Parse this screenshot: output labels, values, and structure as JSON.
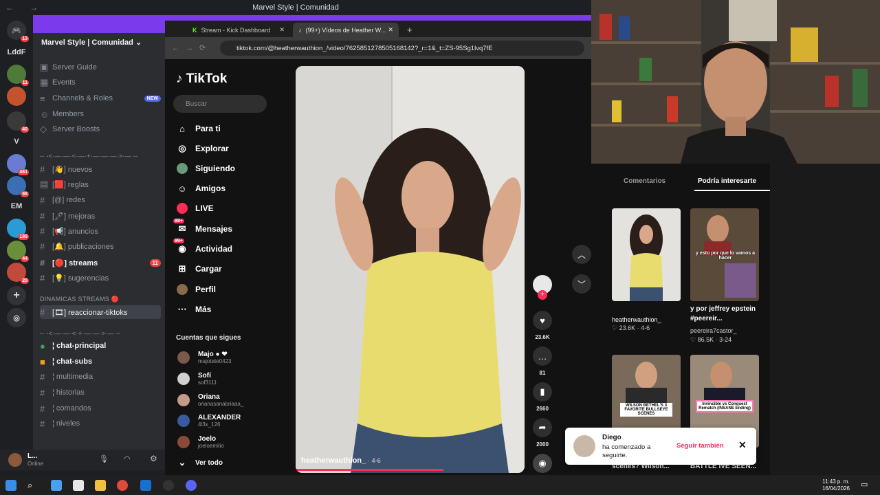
{
  "window_title": "Marvel Style | Comunidad",
  "discord": {
    "guild_name": "Marvel Style | Comunidad",
    "top_items": [
      {
        "label": "Server Guide"
      },
      {
        "label": "Events"
      },
      {
        "label": "Channels & Roles",
        "badge": "NEW"
      },
      {
        "label": "Members"
      },
      {
        "label": "Server Boosts"
      }
    ],
    "divider_1": "-- -<·—·—·<·—·+·—·—·—·>·— --",
    "channels_1": [
      {
        "label": "[👋] nuevos"
      },
      {
        "label": "[🟥] reglas"
      },
      {
        "label": "[@] redes"
      },
      {
        "label": "[🖊] mejoras"
      },
      {
        "label": "[📢] anuncios"
      },
      {
        "label": "[🔔] publicaciones"
      },
      {
        "label": "[🔴] streams",
        "badge": "11"
      },
      {
        "label": "[💡] sugerencias"
      }
    ],
    "category_dinamicas": "DINAMICAS STREAMS 🔴",
    "active_channel": "[🎞] reaccionar-tiktoks",
    "divider_2": "-- -<·—·—·<·+·—·—·>·— --",
    "channels_2": [
      {
        "label": "¦ chat-principal"
      },
      {
        "label": "¦ chat-subs"
      },
      {
        "label": "¦ multimedia"
      },
      {
        "label": "¦ historias"
      },
      {
        "label": "¦ comandos"
      },
      {
        "label": "¦ niveles"
      }
    ],
    "user_name": "L...",
    "user_status": "Online",
    "server_labels": [
      "LddF",
      "V",
      "EM"
    ],
    "server_badges": [
      "13",
      "11",
      "40",
      "461",
      "98",
      "189",
      "44",
      "20"
    ]
  },
  "browser": {
    "tab1": "Stream - Kick Dashboard",
    "tab2": "(99+) Vídeos de Heather W...",
    "url": "tiktok.com/@heatherwauthion_/video/7625851278505168142?_r=1&_t=ZS-95Sg1lvq7fE"
  },
  "tiktok": {
    "logo": "TikTok",
    "search_placeholder": "Buscar",
    "menu": [
      {
        "label": "Para ti",
        "icon": "home-icon"
      },
      {
        "label": "Explorar",
        "icon": "compass-icon"
      },
      {
        "label": "Siguiendo",
        "icon": "following-icon"
      },
      {
        "label": "Amigos",
        "icon": "friends-icon"
      },
      {
        "label": "LIVE",
        "icon": "live-icon"
      },
      {
        "label": "Mensajes",
        "icon": "messages-icon",
        "badge": "99+"
      },
      {
        "label": "Actividad",
        "icon": "activity-icon",
        "badge": "99+"
      },
      {
        "label": "Cargar",
        "icon": "upload-icon"
      },
      {
        "label": "Perfil",
        "icon": "profile-icon"
      },
      {
        "label": "Más",
        "icon": "more-icon"
      }
    ],
    "following_title": "Cuentas que sigues",
    "following": [
      {
        "name": "Majo ● ❤",
        "handle": "majotete0423"
      },
      {
        "name": "Sofí",
        "handle": "sof3111"
      },
      {
        "name": "Oriana",
        "handle": "orianasanabriaaa_"
      },
      {
        "name": "ALEXANDER",
        "handle": "4l3x_126"
      },
      {
        "name": "Joelo",
        "handle": "joeloemilio"
      }
    ],
    "see_all": "Ver todo",
    "video_author": "heatherwauthion_",
    "video_date": "· 4-6",
    "actions": {
      "likes": "23.6K",
      "comments": "81",
      "saves": "2660",
      "shares": "2000"
    },
    "right_tabs": [
      "Comentarios",
      "Podría interesarte"
    ],
    "suggestions": [
      {
        "title": "",
        "author": "heatherwauthion_",
        "meta": "♡ 23.6K · 4-6",
        "overlay": ""
      },
      {
        "title": "y por jeffrey epstein #peereir...",
        "author": "peereira7castor_",
        "meta": "♡ 86.5K · 3-24",
        "overlay": "y esto por que lo vamos a hacer"
      },
      {
        "title": "scenes? Wilson...",
        "author": "",
        "meta": "",
        "overlay": "WILSON BETHEL'S 3 FAVORITE BULLSEYE SCENES"
      },
      {
        "title": "BATTLE IVE SEEN...",
        "author": "",
        "meta": "",
        "overlay": "Invincible vs Conquest Rematch (INSANE Ending)"
      }
    ],
    "toast": {
      "name": "Diego",
      "message": "ha comenzado a seguirte.",
      "follow_back": "Seguir también"
    }
  },
  "taskbar": {
    "time": "11:43 p. m.",
    "date": "16/04/2026"
  }
}
